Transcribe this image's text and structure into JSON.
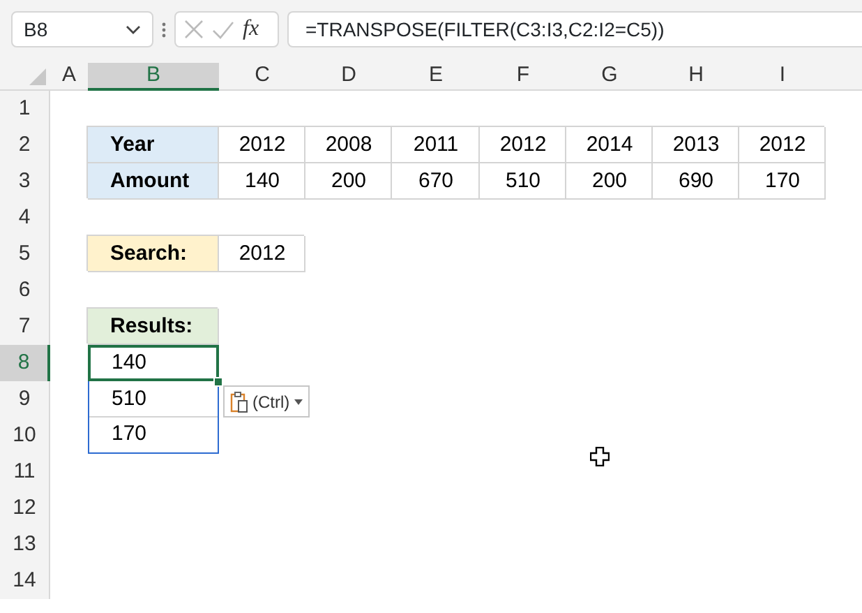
{
  "formula_bar": {
    "name_box": "B8",
    "function_label": "fx",
    "formula": "=TRANSPOSE(FILTER(C3:I3,C2:I2=C5))"
  },
  "columns": [
    {
      "label": "A",
      "selected": false
    },
    {
      "label": "B",
      "selected": true
    },
    {
      "label": "C",
      "selected": false
    },
    {
      "label": "D",
      "selected": false
    },
    {
      "label": "E",
      "selected": false
    },
    {
      "label": "F",
      "selected": false
    },
    {
      "label": "G",
      "selected": false
    },
    {
      "label": "H",
      "selected": false
    },
    {
      "label": "I",
      "selected": false
    }
  ],
  "rows": [
    {
      "label": "1",
      "selected": false
    },
    {
      "label": "2",
      "selected": false,
      "cells": [
        null,
        {
          "text": "Year",
          "kind": "label",
          "color": "#ddebf7",
          "selected": false
        },
        {
          "text": "2012",
          "kind": "value",
          "selected": false
        },
        {
          "text": "2008",
          "kind": "value",
          "selected": false
        },
        {
          "text": "2011",
          "kind": "value",
          "selected": false
        },
        {
          "text": "2012",
          "kind": "value",
          "selected": false
        },
        {
          "text": "2014",
          "kind": "value",
          "selected": false
        },
        {
          "text": "2013",
          "kind": "value",
          "selected": false
        },
        {
          "text": "2012",
          "kind": "value",
          "selected": false
        }
      ]
    },
    {
      "label": "3",
      "selected": false,
      "cells": [
        null,
        {
          "text": "Amount",
          "kind": "label",
          "color": "#ddebf7",
          "selected": false
        },
        {
          "text": "140",
          "kind": "value",
          "selected": false
        },
        {
          "text": "200",
          "kind": "value",
          "selected": false
        },
        {
          "text": "670",
          "kind": "value",
          "selected": false
        },
        {
          "text": "510",
          "kind": "value",
          "selected": false
        },
        {
          "text": "200",
          "kind": "value",
          "selected": false
        },
        {
          "text": "690",
          "kind": "value",
          "selected": false
        },
        {
          "text": "170",
          "kind": "value",
          "selected": false
        }
      ]
    },
    {
      "label": "4",
      "selected": false
    },
    {
      "label": "5",
      "selected": false,
      "cells": [
        null,
        {
          "text": "Search:",
          "kind": "label",
          "color": "#fff2cc",
          "selected": false
        },
        {
          "text": "2012",
          "kind": "value",
          "selected": false
        }
      ]
    },
    {
      "label": "6",
      "selected": false
    },
    {
      "label": "7",
      "selected": false,
      "cells": [
        null,
        {
          "text": "Results:",
          "kind": "label",
          "color": "#e2efda",
          "selected": false
        }
      ]
    },
    {
      "label": "8",
      "selected": true,
      "cells": [
        null,
        {
          "text": "140",
          "kind": "spill",
          "selected": true
        }
      ]
    },
    {
      "label": "9",
      "selected": false,
      "cells": [
        null,
        {
          "text": "510",
          "kind": "spill",
          "selected": false
        }
      ]
    },
    {
      "label": "10",
      "selected": false,
      "cells": [
        null,
        {
          "text": "170",
          "kind": "spill",
          "selected": false
        }
      ]
    },
    {
      "label": "11",
      "selected": false
    },
    {
      "label": "12",
      "selected": false
    },
    {
      "label": "13",
      "selected": false
    },
    {
      "label": "14",
      "selected": false
    }
  ],
  "paste_options": {
    "label": "(Ctrl)"
  }
}
